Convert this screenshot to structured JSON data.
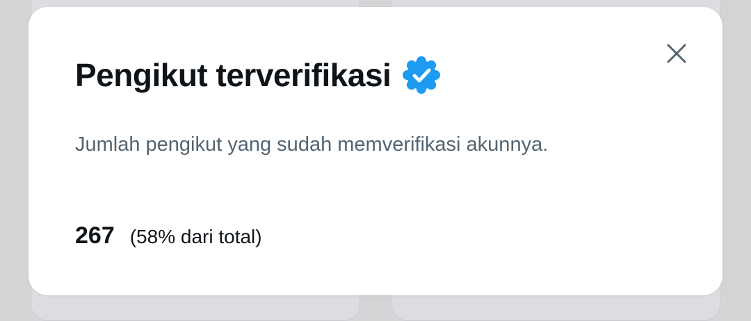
{
  "dialog": {
    "title": "Pengikut terverifikasi",
    "badge_icon": "verified-badge-icon",
    "badge_color": "#1d9bf0",
    "close_icon": "close-icon",
    "description": "Jumlah pengikut yang sudah memverifikasi akunnya.",
    "count": "267",
    "percent_text": "(58% dari total)"
  }
}
